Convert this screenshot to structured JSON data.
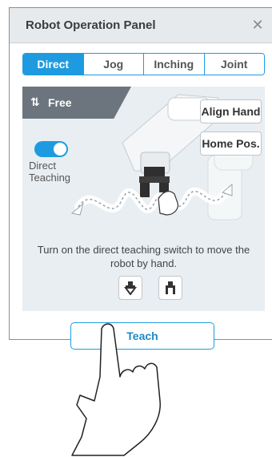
{
  "panel": {
    "title": "Robot Operation Panel",
    "close_icon": "close-icon",
    "tabs": [
      {
        "label": "Direct",
        "active": true
      },
      {
        "label": "Jog",
        "active": false
      },
      {
        "label": "Inching",
        "active": false
      },
      {
        "label": "Joint",
        "active": false
      }
    ],
    "mode": {
      "icon": "free-mode-icon",
      "label": "Free"
    },
    "buttons": {
      "align_hand": "Align Hand",
      "home_pos": "Home Pos."
    },
    "direct_teaching": {
      "label": "Direct Teaching",
      "on": true
    },
    "instructions": "Turn on the direct teaching switch to move the robot by hand.",
    "gripper_buttons": [
      "gripper-open-icon",
      "gripper-close-icon"
    ]
  },
  "action": {
    "teach_label": "Teach"
  },
  "colors": {
    "accent": "#1e9be0",
    "banner": "#6c757d",
    "area_bg": "#e9eef2",
    "header_bg": "#e6eaed"
  }
}
